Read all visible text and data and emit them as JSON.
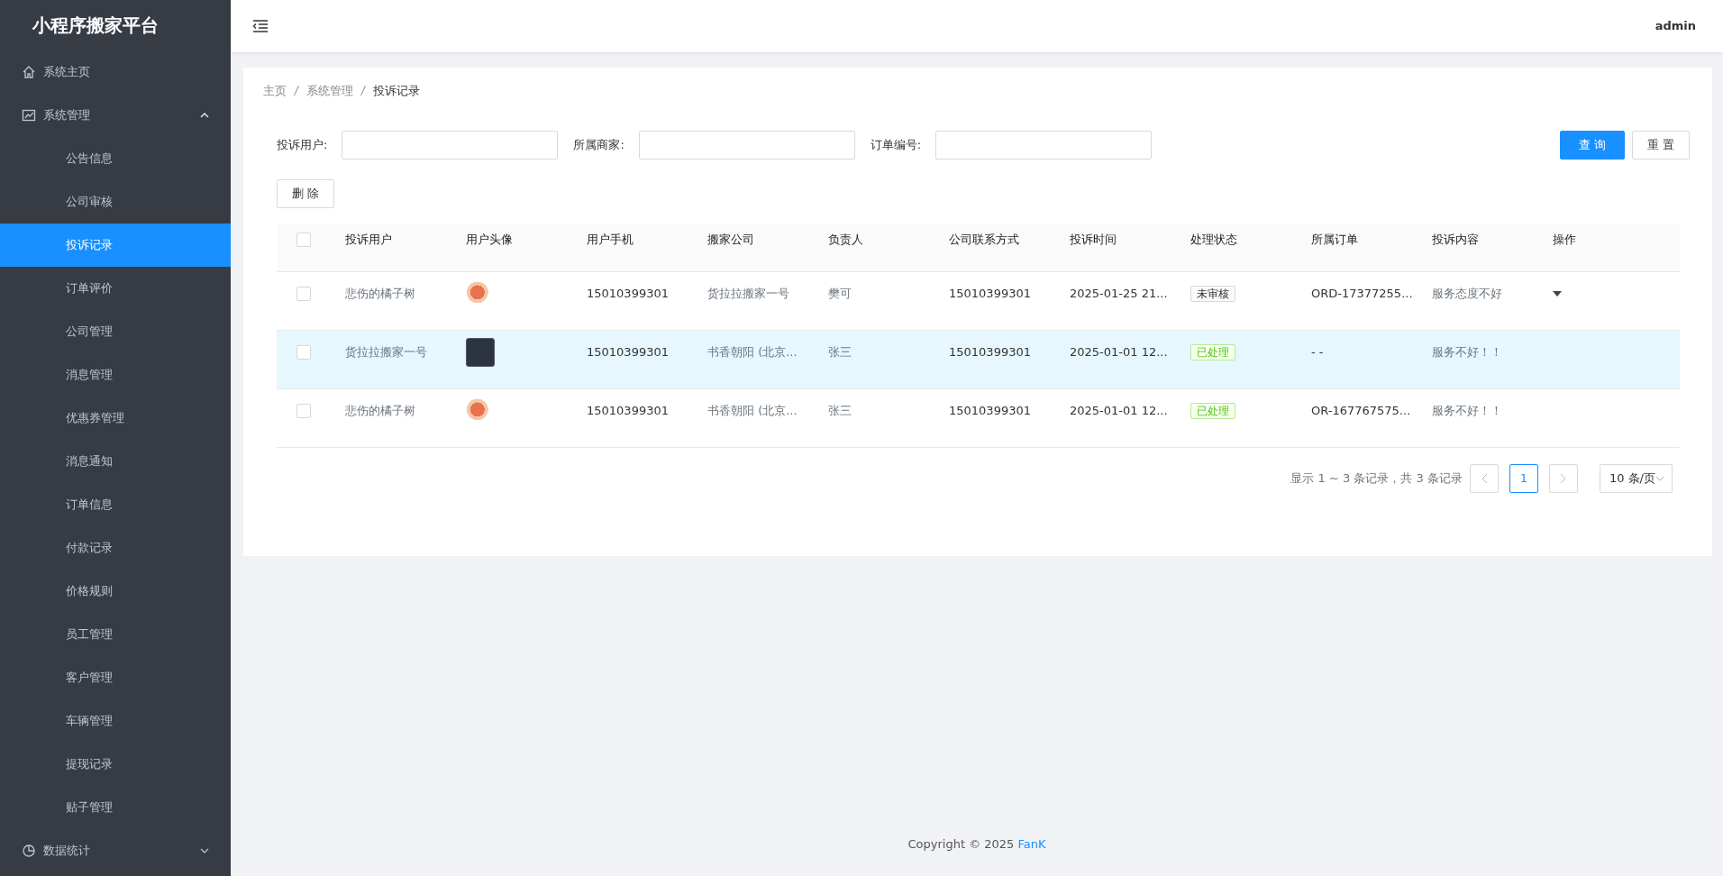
{
  "sidebar": {
    "title": "小程序搬家平台",
    "items": [
      {
        "label": "系统主页"
      },
      {
        "label": "系统管理",
        "expanded": true,
        "children": [
          {
            "label": "公告信息",
            "selected": false
          },
          {
            "label": "公司审核",
            "selected": false
          },
          {
            "label": "投诉记录",
            "selected": true
          },
          {
            "label": "订单评价",
            "selected": false
          },
          {
            "label": "公司管理",
            "selected": false
          },
          {
            "label": "消息管理",
            "selected": false
          },
          {
            "label": "优惠券管理",
            "selected": false
          },
          {
            "label": "消息通知",
            "selected": false
          },
          {
            "label": "订单信息",
            "selected": false
          },
          {
            "label": "付款记录",
            "selected": false
          },
          {
            "label": "价格规则",
            "selected": false
          },
          {
            "label": "员工管理",
            "selected": false
          },
          {
            "label": "客户管理",
            "selected": false
          },
          {
            "label": "车辆管理",
            "selected": false
          },
          {
            "label": "提现记录",
            "selected": false
          },
          {
            "label": "贴子管理",
            "selected": false
          }
        ]
      },
      {
        "label": "数据统计",
        "expanded": false
      }
    ]
  },
  "header": {
    "user": "admin"
  },
  "breadcrumb": [
    "主页",
    "系统管理",
    "投诉记录"
  ],
  "filters": [
    {
      "label": "投诉用户:"
    },
    {
      "label": "所属商家:"
    },
    {
      "label": "订单编号:"
    }
  ],
  "buttons": {
    "search": "查 询",
    "reset": "重 置",
    "delete": "删 除"
  },
  "table": {
    "columns": [
      "投诉用户",
      "用户头像",
      "用户手机",
      "搬家公司",
      "负责人",
      "公司联系方式",
      "投诉时间",
      "处理状态",
      "所属订单",
      "投诉内容",
      "操作"
    ],
    "header_checked": false,
    "rows": [
      {
        "checked": false,
        "highlighted": false,
        "user": "悲伤的橘子树",
        "phone": "15010399301",
        "company": "货拉拉搬家一号",
        "manager": "樊可",
        "contact": "15010399301",
        "time": "2025-01-25 21...",
        "status": {
          "text": "未审核",
          "kind": "pending"
        },
        "order": "ORD-17377255...",
        "content": "服务态度不好",
        "action_menu": true
      },
      {
        "checked": false,
        "highlighted": true,
        "user": "货拉拉搬家一号",
        "phone": "15010399301",
        "company": "书香朝阳 (北京...",
        "manager": "张三",
        "contact": "15010399301",
        "time": "2025-01-01 12...",
        "status": {
          "text": "已处理",
          "kind": "done"
        },
        "order": "- -",
        "content": "服务不好！！",
        "action_menu": false
      },
      {
        "checked": false,
        "highlighted": false,
        "user": "悲伤的橘子树",
        "phone": "15010399301",
        "company": "书香朝阳 (北京...",
        "manager": "张三",
        "contact": "15010399301",
        "time": "2025-01-01 12...",
        "status": {
          "text": "已处理",
          "kind": "done"
        },
        "order": "OR-167767575...",
        "content": "服务不好！！",
        "action_menu": false
      }
    ]
  },
  "pagination": {
    "summary": "显示 1 ~ 3 条记录，共 3 条记录",
    "pages": [
      {
        "label": "1",
        "selected": true
      }
    ],
    "page_size": "10 条/页"
  },
  "footer": {
    "text": "Copyright © 2025",
    "author": "FanK"
  }
}
